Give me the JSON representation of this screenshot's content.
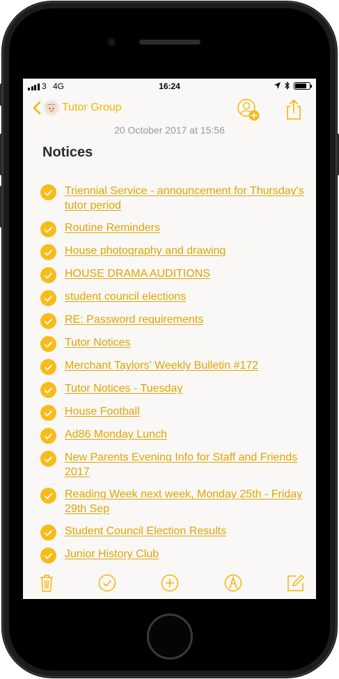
{
  "status_bar": {
    "carrier": "3",
    "network": "4G",
    "time": "16:24",
    "battery_level": 0.8
  },
  "nav": {
    "back_label": "Tutor Group",
    "avatar_icon": "person-face-icon",
    "add_person_icon": "add-person-icon",
    "share_icon": "share-icon"
  },
  "note": {
    "date": "20 October 2017 at 15:56",
    "title": "Notices",
    "items": [
      {
        "text": "Triennial Service - announcement for Thursday's tutor period",
        "checked": true
      },
      {
        "text": "Routine Reminders",
        "checked": true
      },
      {
        "text": "House photography and drawing",
        "checked": true
      },
      {
        "text": "HOUSE DRAMA AUDITIONS",
        "checked": true
      },
      {
        "text": "student council elections",
        "checked": true
      },
      {
        "text": "RE: Password requirements",
        "checked": true
      },
      {
        "text": "Tutor Notices",
        "checked": true
      },
      {
        "text": "Merchant Taylors' Weekly Bulletin #172",
        "checked": true
      },
      {
        "text": "Tutor Notices - Tuesday",
        "checked": true
      },
      {
        "text": "House Football",
        "checked": true
      },
      {
        "text": "Ad86 Monday Lunch",
        "checked": true
      },
      {
        "text": "New Parents Evening Info for Staff and Friends 2017",
        "checked": true
      },
      {
        "text": "Reading Week next week, Monday 25th - Friday 29th Sep",
        "checked": true
      },
      {
        "text": "Student Council Election Results",
        "checked": true
      },
      {
        "text": "Junior History Club",
        "checked": true
      }
    ]
  },
  "toolbar": {
    "icons": [
      "trash-icon",
      "checklist-icon",
      "add-icon",
      "markup-icon",
      "compose-icon"
    ]
  },
  "colors": {
    "accent": "#f5b400",
    "check_fill": "#f8bb1a",
    "link_text": "#e0a400",
    "background": "#f9f8f6"
  }
}
